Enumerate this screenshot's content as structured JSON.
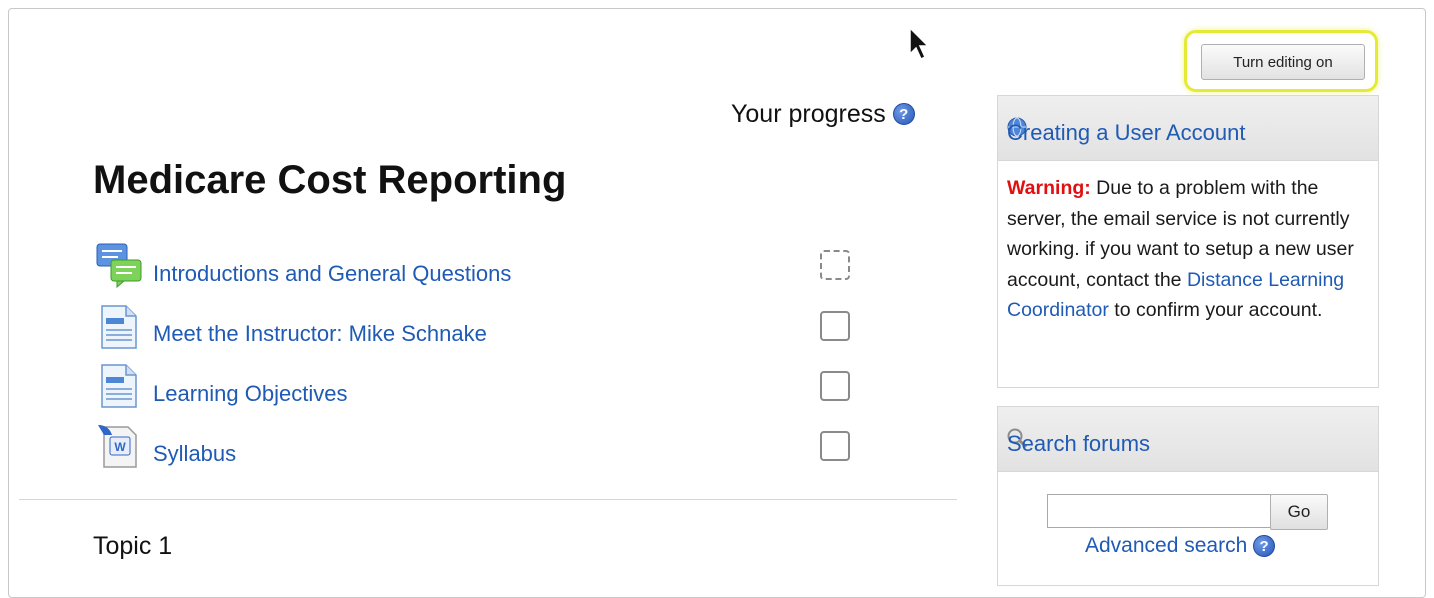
{
  "header": {
    "edit_button_label": "Turn editing on"
  },
  "progress": {
    "label": "Your progress",
    "help_glyph": "?"
  },
  "course": {
    "title": "Medicare Cost Reporting",
    "items": [
      {
        "label": "Introductions and General Questions",
        "icon": "forum-icon",
        "completion": "auto"
      },
      {
        "label": "Meet the Instructor: Mike Schnake",
        "icon": "page-icon",
        "completion": "manual"
      },
      {
        "label": "Learning Objectives",
        "icon": "page-icon",
        "completion": "manual"
      },
      {
        "label": "Syllabus",
        "icon": "word-document-icon",
        "completion": "manual"
      }
    ],
    "topic_label": "Topic 1"
  },
  "account_block": {
    "title": "Creating a User Account",
    "warning_label": "Warning:",
    "message_part1": " Due to a problem with the server, the email service is not currently working. if you want to setup a new user account, contact the ",
    "link_text": "Distance Learning Coordinator",
    "message_part2": " to confirm your account."
  },
  "search_block": {
    "title": "Search forums",
    "input_value": "",
    "go_label": "Go",
    "advanced_label": "Advanced search",
    "help_glyph": "?"
  },
  "colors": {
    "link": "#1f5ab5",
    "warning": "#e01010",
    "highlight": "#e5ea36"
  }
}
